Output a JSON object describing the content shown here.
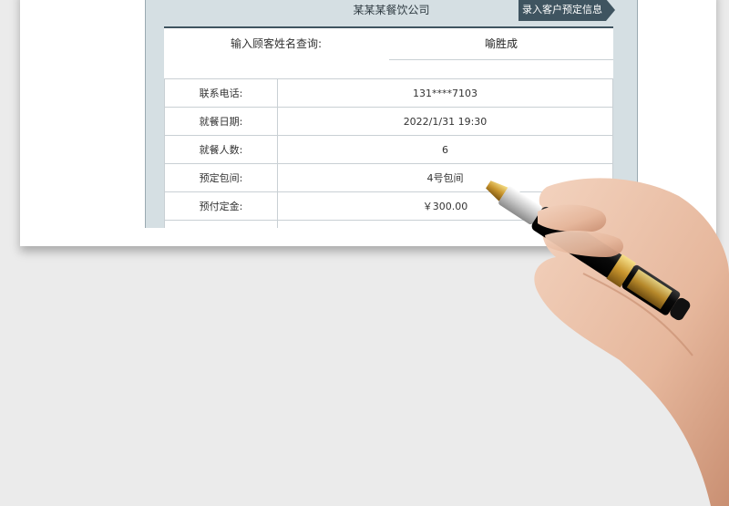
{
  "header": {
    "company": "某某某餐饮公司",
    "entry_button": "录入客户预定信息"
  },
  "query": {
    "label": "输入顾客姓名查询:",
    "value": "喻胜成"
  },
  "rows": [
    {
      "key": "联系电话:",
      "value": "131****7103"
    },
    {
      "key": "就餐日期:",
      "value": "2022/1/31 19:30"
    },
    {
      "key": "就餐人数:",
      "value": "6"
    },
    {
      "key": "预定包间:",
      "value": "4号包间"
    },
    {
      "key": "预付定金:",
      "value": "￥300.00"
    },
    {
      "key": "",
      "value": ""
    }
  ],
  "colors": {
    "accent": "#3f5460",
    "sheet_bg": "#d5dfe3",
    "background": "#ebebeb"
  }
}
